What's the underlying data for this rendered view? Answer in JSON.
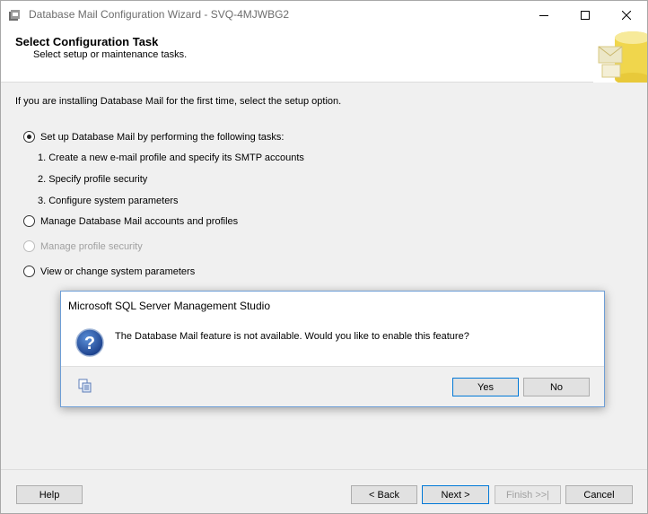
{
  "window": {
    "title": "Database Mail Configuration Wizard - SVQ-4MJWBG2",
    "minimize_glyph": "—",
    "maximize_glyph": "☐",
    "close_glyph": "✕"
  },
  "banner": {
    "title": "Select Configuration Task",
    "subtitle": "Select setup or maintenance tasks."
  },
  "main": {
    "intro": "If you are installing Database Mail for the first time, select the setup option.",
    "options": [
      {
        "label": "Set up Database Mail by performing the following tasks:",
        "checked": true,
        "enabled": true
      },
      {
        "label": "Manage Database Mail accounts and profiles",
        "checked": false,
        "enabled": true
      },
      {
        "label": "Manage profile security",
        "checked": false,
        "enabled": false
      },
      {
        "label": "View or change system parameters",
        "checked": false,
        "enabled": true
      }
    ],
    "steps": [
      "1. Create a new e-mail profile and specify its SMTP accounts",
      "2. Specify profile security",
      "3. Configure system parameters"
    ]
  },
  "footer": {
    "help": "Help",
    "back": "< Back",
    "next": "Next >",
    "finish": "Finish >>|",
    "cancel": "Cancel"
  },
  "dialog": {
    "title": "Microsoft SQL Server Management Studio",
    "message": "The Database Mail feature is not available.  Would you like to enable this feature?",
    "yes": "Yes",
    "no": "No",
    "icon": "question-icon"
  },
  "colors": {
    "focus_border": "#0078d7",
    "disabled_text": "#a0a0a0",
    "dialog_border": "#6e9ed6"
  }
}
